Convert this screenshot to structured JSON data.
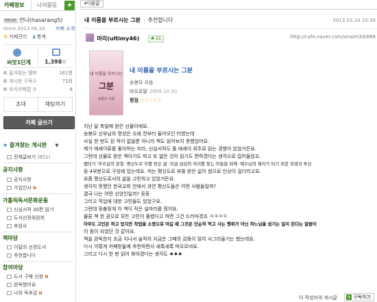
{
  "sidebar": {
    "tabs": {
      "cafe_info": "카페정보",
      "my_activity": "나의활동",
      "favorites_icon": "star-icon"
    },
    "profile": {
      "level_chip": "BBLUR",
      "nickname": "안나(hasarang5)",
      "since": "since 2013.04.10",
      "invite_link": "카페 소개",
      "cafe_manage": "카페관리",
      "stats_link": "통계"
    },
    "level": {
      "label": "씨앗1단계",
      "visits": "1,398",
      "visits_unit": "회"
    },
    "stats": [
      {
        "label": "즐겨찾는 멤버",
        "value": "161명"
      },
      {
        "label": "게시판 구독수",
        "value": "71회"
      },
      {
        "label": "우리카페앱 수",
        "value": "8"
      }
    ],
    "buttons": {
      "invite": "초대",
      "chat": "채팅하기",
      "write": "카페 글쓰기"
    },
    "menus": {
      "favorites_heading": "즐겨찾는 게시판",
      "all_posts": "전체글보기",
      "all_posts_count": "(651)",
      "notice_heading": "공지사항",
      "notice_items": [
        "공지사항",
        "가입인사"
      ],
      "community_heading": "가톨릭독서문화운동",
      "community_items": [
        "신심서적 30편 읽기",
        "도서선정위원회",
        "후원사"
      ],
      "book_heading": "책마당",
      "book_items": [
        "이달의 선정도서",
        "추천합니다"
      ],
      "participation_heading": "참여마당",
      "participation_items": [
        "도서 구매 신청",
        "완독했어요",
        "나의 독후감"
      ],
      "new_badge": "N"
    }
  },
  "post": {
    "list_button": "다음글",
    "title": "내 이름을 부르시는 그분",
    "category": "추천합니다",
    "date": "2013.10.24 10:34",
    "author": "마리(ultimy46)",
    "author_level": "11",
    "url": "http://cafe.naver.com/sinsim33/868",
    "book": {
      "title": "내 이름을 부르시는 그분",
      "author": "송봉모 지음",
      "publisher": "바오로딸",
      "pub_date": "2009.10.20",
      "rating_label": "평점",
      "stars": "☆☆☆☆☆",
      "cover_title": "내 이름을 부르시는",
      "cover_big": "그분",
      "cover_sub": "송봉모 지음"
    },
    "body": [
      "지난 달 축일때 받은 선물이에요.",
      "송봉모 신부님의 명성은 오래 전부터 들어오던 터였는데",
      "사실 한 번도 된 적이 없을뿐 아니라 책도 읽어보지 못했었어요.",
      "제가 에세이류를 좋아하는 지라, 신심서적도 좀 에세이 위주로 읽는 경향이 있었거든요.",
      "그런데 선물로 받은 책이기도 하고 또 얇은 것이 읽기도 편하겠다는 생각으로 집어들었죠.",
      "랩터가 '후르심의 본질 ·평신도로 부를 받은 삶 ·지금 섬김의 자리를 찾는 이들을 위해 ·예수님의 제자가 되기 위한 희생과 투신",
      "등 4부분으로 구성돼 있는데요. 저는 평신도로 부를 받은 삶이 참으로 인상이 깊더라고요.",
      "요즘 평신도로서의 삶을 고민하고 있었거든요.",
      "생각지 못했던 한국교회 안에서 과연 평신도들은 어떤 사람들일까?",
      "결국 나는 어떤 신앙인일까? 등등",
      "그리고 직업에 대한 고민들도 있었구요.",
      "그런데 맞춤맞게 이 책이 작은 실마리를 줬어요.",
      "물론 책 한 권으로 모든 고민이 풀렸다고 하면 그건 드라마겠죠 ㅋㅋㅋㅋ",
      "아무도 고민은 하고 있지만 작업을 소명으로 여길 때 그것은 단순히 먹고 사는 행위가 아닌 하느님을 섬기는 일이 된다는 말씀이",
      "이 힘이 되었던 것 같아요.",
      "책을 완독한지 조금 지나서 솔직히 지금은 그때의 감동이 많이 사그라들기는 했는데요.",
      "다시 이렇게 카페방들께 추천하면서 새록새록 떠오르네요.",
      "그리고 다시 한 번 읽어 봐야겠다는 생각도 ♠♠♠"
    ],
    "my_posts_link": "이 작성자의 게시글",
    "subscribe_button": "구독하기",
    "subscribe_icon": "plus-icon"
  }
}
